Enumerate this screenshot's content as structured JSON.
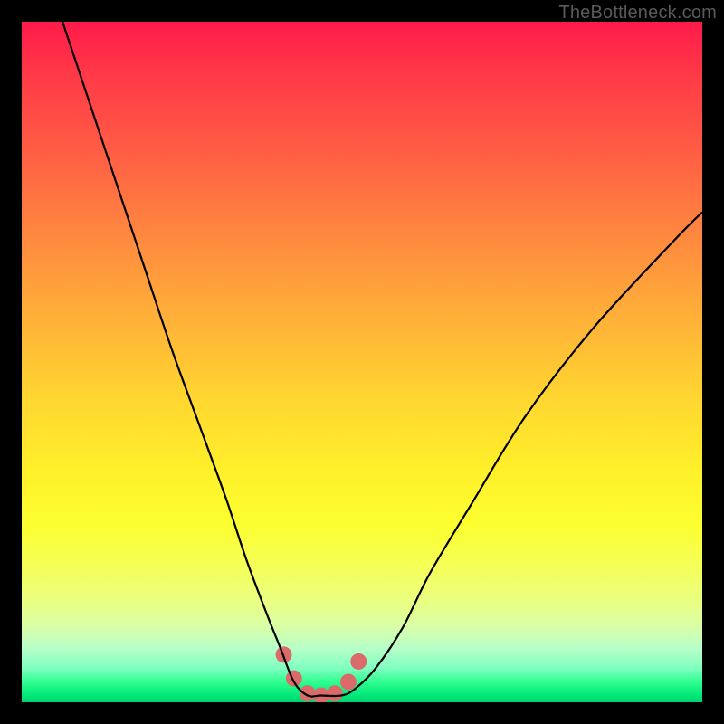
{
  "watermark": "TheBottleneck.com",
  "chart_data": {
    "type": "line",
    "title": "",
    "xlabel": "",
    "ylabel": "",
    "xlim": [
      0,
      100
    ],
    "ylim": [
      0,
      100
    ],
    "grid": false,
    "legend": false,
    "series": [
      {
        "name": "bottleneck-curve",
        "x": [
          6,
          10,
          14,
          18,
          22,
          26,
          30,
          33,
          36,
          38,
          40,
          42,
          44,
          47,
          49,
          52,
          56,
          60,
          66,
          74,
          84,
          96,
          100
        ],
        "y": [
          100,
          88,
          76,
          64,
          52,
          41,
          30,
          21,
          13,
          8,
          3,
          1,
          1,
          1,
          2,
          5,
          11,
          19,
          29,
          42,
          55,
          68,
          72
        ]
      }
    ],
    "annotations": {
      "valley_marker": {
        "x": [
          38.5,
          40,
          42,
          44,
          46,
          48,
          49.5
        ],
        "y": [
          7,
          3.5,
          1.3,
          1,
          1.3,
          3,
          6
        ],
        "color": "#db6b6b"
      }
    },
    "background_gradient": {
      "top": "#ff1a4a",
      "mid": "#fff02a",
      "bottom": "#00d070"
    }
  }
}
